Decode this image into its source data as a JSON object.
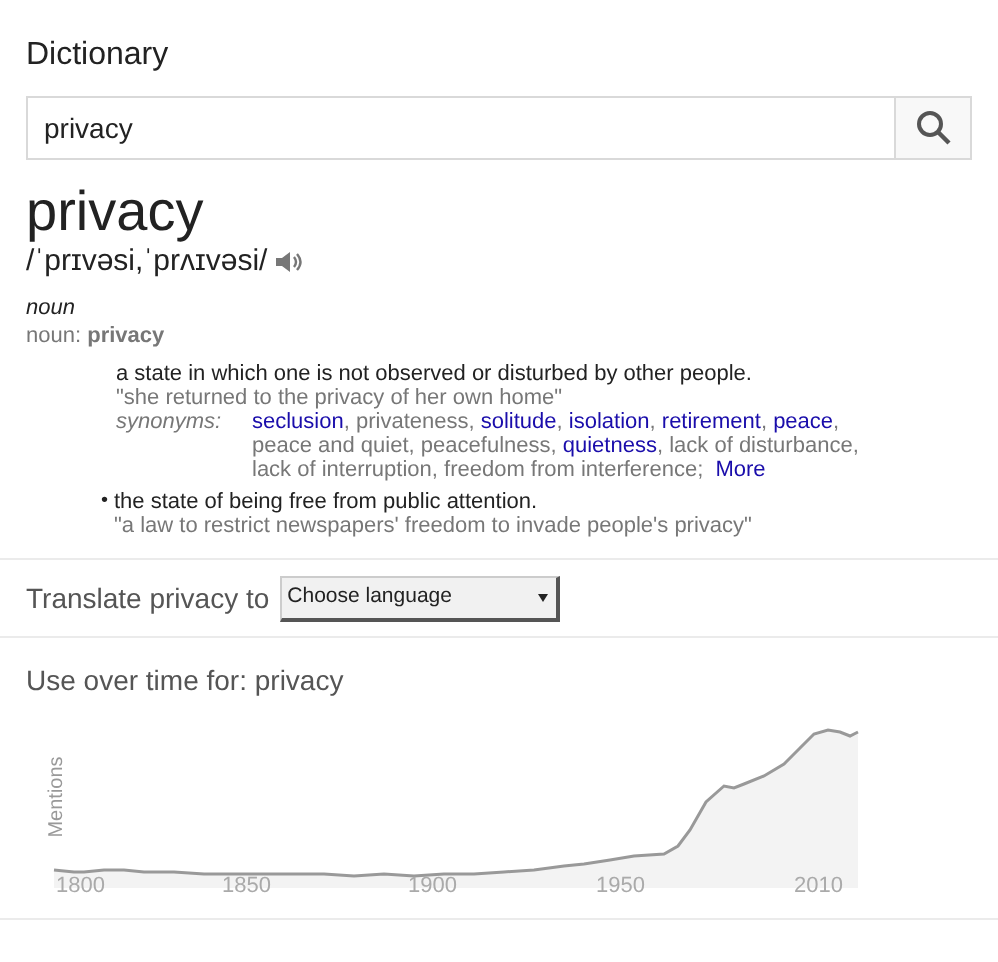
{
  "section_title": "Dictionary",
  "search": {
    "value": "privacy"
  },
  "headword": "privacy",
  "pronunciation": "/ˈprɪvəsi,ˈprʌɪvəsi/",
  "part_of_speech": "noun",
  "form": "noun: **privacy**",
  "senses": [
    {
      "definition": "a state in which one is not observed or disturbed by other people.",
      "example": "\"she returned to the privacy of her own home\"",
      "synonyms_label": "synonyms:",
      "synonyms": [
        {
          "text": "seclusion",
          "link": true,
          "sep": ", "
        },
        {
          "text": "privateness",
          "link": false,
          "sep": ", "
        },
        {
          "text": "solitude",
          "link": true,
          "sep": ", "
        },
        {
          "text": "isolation",
          "link": true,
          "sep": ", "
        },
        {
          "text": "retirement",
          "link": true,
          "sep": ", "
        },
        {
          "text": "peace",
          "link": true,
          "sep": ", "
        },
        {
          "text": "peace and quiet",
          "link": false,
          "sep": ", "
        },
        {
          "text": "peacefulness",
          "link": false,
          "sep": ", "
        },
        {
          "text": "quietness",
          "link": true,
          "sep": ", "
        },
        {
          "text": "lack of disturbance",
          "link": false,
          "sep": ", "
        },
        {
          "text": "lack of interruption",
          "link": false,
          "sep": ", "
        },
        {
          "text": "freedom from interference",
          "link": false,
          "sep": "; "
        }
      ],
      "more": "More"
    },
    {
      "marker": "•",
      "definition": "the state of being free from public attention.",
      "example": "\"a law to restrict newspapers' freedom to invade people's privacy\""
    }
  ],
  "translate": {
    "label": "Translate privacy to",
    "select": "Choose language"
  },
  "usage": {
    "title": "Use over time for: privacy",
    "ylabel": "Mentions",
    "x_labels": [
      "1800",
      "1850",
      "1900",
      "1950",
      "2010"
    ]
  }
}
